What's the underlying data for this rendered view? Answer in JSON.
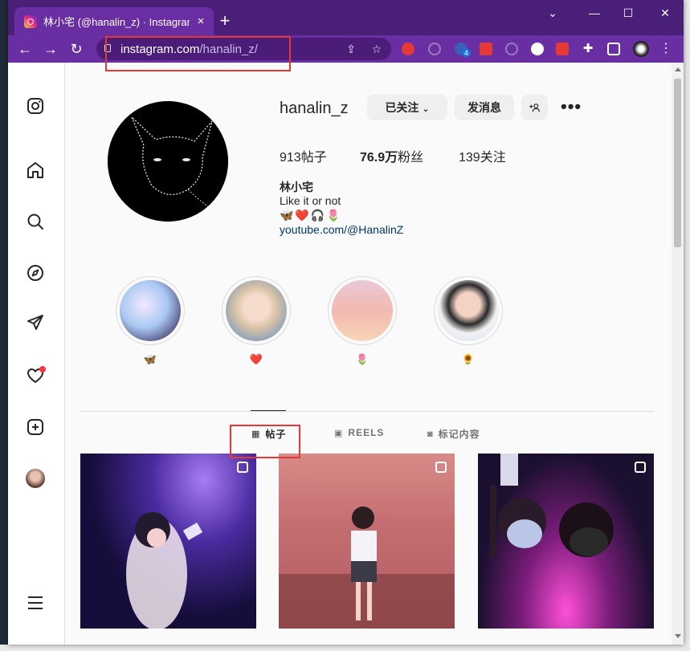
{
  "browser": {
    "tab_title": "林小宅 (@hanalin_z) · Instagram",
    "tab_close": "×",
    "new_tab": "+",
    "url_host": "instagram.com",
    "url_path": "/hanalin_z/",
    "extension_badge": "4",
    "controls": {
      "minimize": "—",
      "maximize": "☐",
      "close": "✕",
      "chevron": "⌄"
    }
  },
  "profile": {
    "username": "hanalin_z",
    "following_button": "已关注",
    "message_button": "发消息",
    "more": "•••",
    "stats": {
      "posts_count": "913",
      "posts_label": "帖子",
      "followers_count": "76.9万",
      "followers_label": "粉丝",
      "following_count": "139",
      "following_label": "关注"
    },
    "full_name": "林小宅",
    "bio": "Like it or not",
    "emojis": "🦋❤️🎧🌷",
    "link": "youtube.com/@HanalinZ"
  },
  "highlights": [
    {
      "label": "🦋"
    },
    {
      "label": "❤️"
    },
    {
      "label": "🌷"
    },
    {
      "label": "🌻"
    }
  ],
  "tabs": {
    "posts": "帖子",
    "reels": "REELS",
    "tagged": "标记内容"
  },
  "colors": {
    "tab_strip": "#4a1f7a",
    "toolbar": "#6a2ea3",
    "highlight_box": "#e53935",
    "link": "#00376b"
  }
}
